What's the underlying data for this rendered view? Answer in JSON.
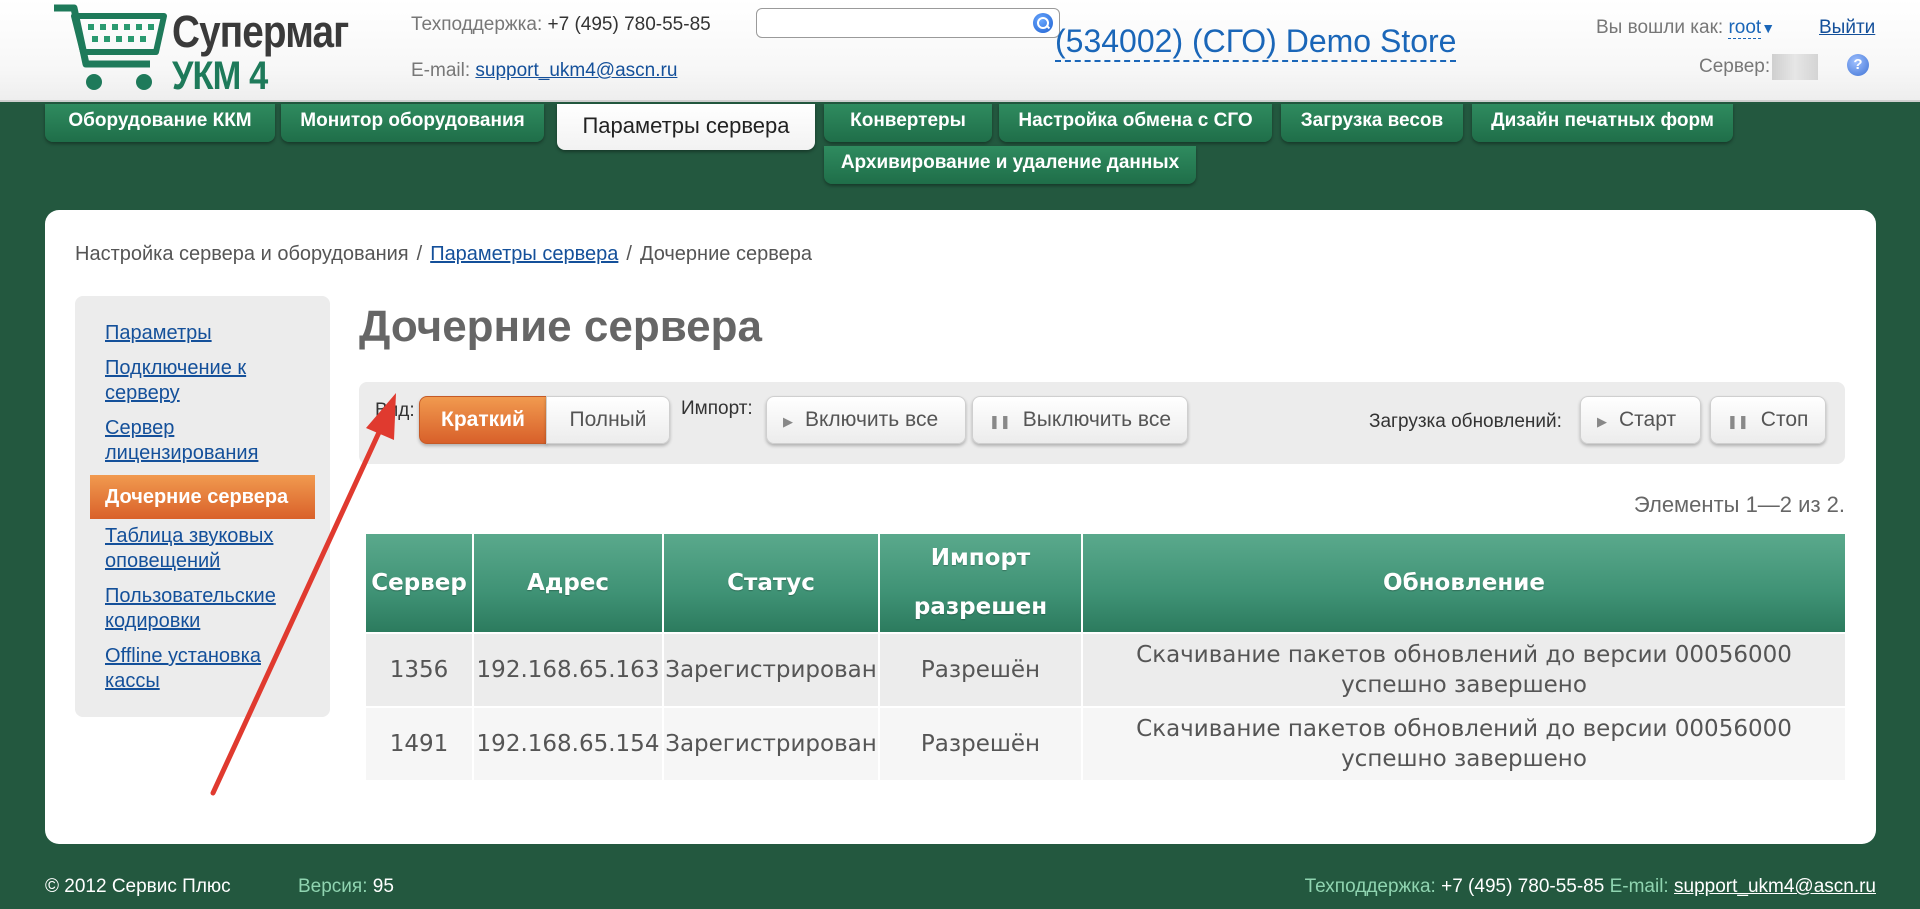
{
  "header": {
    "logo_title": "Супермаг",
    "logo_sub": "УКМ 4",
    "support_label": "Техподдержка:",
    "support_phone": "+7 (495) 780-55-85",
    "email_label": "E-mail:",
    "email": "support_ukm4@ascn.ru",
    "search_value": "",
    "store_name": "(534002) (СГО) Demo Store",
    "login_label": "Вы вошли как:",
    "login_user": "root",
    "logout": "Выйти",
    "server_label": "Сервер:",
    "help": "?"
  },
  "nav": {
    "tabs": [
      {
        "label": "Оборудование ККМ"
      },
      {
        "label": "Монитор оборудования"
      },
      {
        "label": "Параметры сервера",
        "active": true
      },
      {
        "label": "Конвертеры"
      },
      {
        "label": "Настройка обмена с СГО"
      },
      {
        "label": "Загрузка весов"
      },
      {
        "label": "Дизайн печатных форм"
      },
      {
        "label": "Архивирование и удаление данных"
      }
    ]
  },
  "breadcrumb": {
    "items": [
      "Настройка сервера и оборудования",
      "Параметры сервера",
      "Дочерние сервера"
    ],
    "separator": "/"
  },
  "sidebar": {
    "items": [
      {
        "label": "Параметры"
      },
      {
        "label": "Подключение к серверу"
      },
      {
        "label": "Сервер лицензирования"
      },
      {
        "label": "Дочерние сервера",
        "active": true
      },
      {
        "label": "Таблица звуковых оповещений"
      },
      {
        "label": "Пользовательские кодировки"
      },
      {
        "label": "Offline установка кассы"
      }
    ]
  },
  "main": {
    "title": "Дочерние сервера",
    "toolbar": {
      "view_label": "Вид:",
      "view_short": "Краткий",
      "view_full": "Полный",
      "import_label": "Импорт:",
      "enable_all": "Включить все",
      "disable_all": "Выключить все",
      "updates_label": "Загрузка обновлений:",
      "start": "Старт",
      "stop": "Стоп"
    },
    "count": "Элементы 1—2 из 2.",
    "table": {
      "headers": [
        "Сервер",
        "Адрес",
        "Статус",
        "Импорт разрешен",
        "Обновление"
      ],
      "rows": [
        [
          "1356",
          "192.168.65.163",
          "Зарегистрирован",
          "Разрешён",
          "Скачивание пакетов обновлений до версии 00056000 успешно завершено"
        ],
        [
          "1491",
          "192.168.65.154",
          "Зарегистрирован",
          "Разрешён",
          "Скачивание пакетов обновлений до версии 00056000 успешно завершено"
        ]
      ]
    }
  },
  "footer": {
    "copyright": "© 2012 Сервис Плюс",
    "version_label": "Версия:",
    "version": "95",
    "support_label": "Техподдержка:",
    "support_phone": "+7 (495) 780-55-85",
    "email_label": "E-mail:",
    "email": "support_ukm4@ascn.ru"
  },
  "colors": {
    "brand_green": "#23583f",
    "accent_orange": "#d9612a",
    "link_blue": "#14509a",
    "annotation_red": "#e03a2f"
  }
}
